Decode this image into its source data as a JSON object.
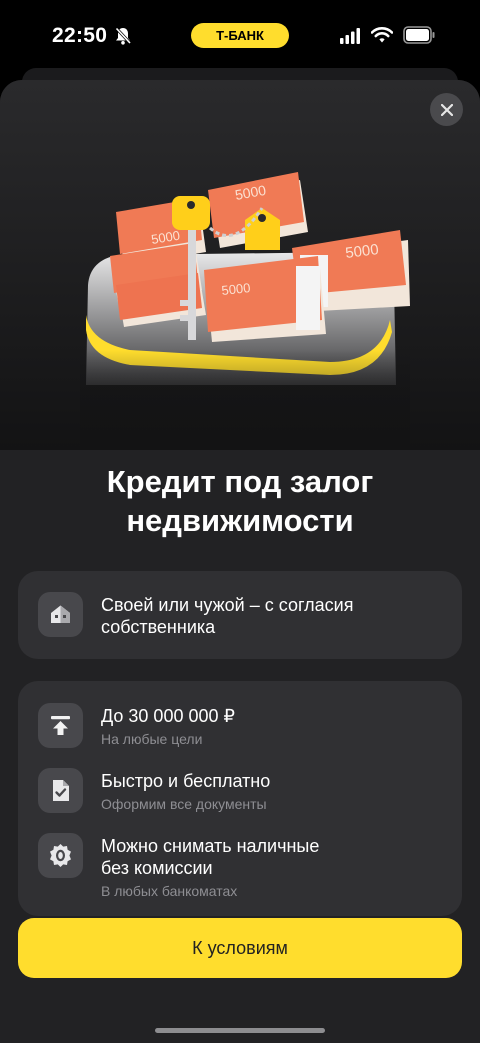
{
  "status_bar": {
    "time": "22:50",
    "bank_pill": "Т-БАНК",
    "icons": [
      "bell-off-icon",
      "cellular-signal-icon",
      "wifi-icon",
      "battery-icon"
    ]
  },
  "hero": {
    "banknote_denomination": "5000",
    "close_icon": "close-icon"
  },
  "title_line1": "Кредит под залог",
  "title_line2": "недвижимости",
  "card1": {
    "icon": "house-icon",
    "title_line1": "Своей или чужой – с согласия",
    "title_line2": "собственника"
  },
  "card2": {
    "items": [
      {
        "icon": "upload-limit-icon",
        "title_line1": "До 30 000 000 ₽",
        "subtitle": "На любые цели"
      },
      {
        "icon": "document-check-icon",
        "title_line1": "Быстро и бесплатно",
        "subtitle": "Оформим все документы"
      },
      {
        "icon": "zero-commission-icon",
        "title_line1": "Можно снимать наличные",
        "title_line2": "без комиссии",
        "subtitle": "В любых банкоматах"
      }
    ]
  },
  "cta_label": "К условиям",
  "colors": {
    "accent": "#ffdd2d",
    "background": "#222224",
    "card": "#303033",
    "muted_text": "#8e8e93"
  }
}
